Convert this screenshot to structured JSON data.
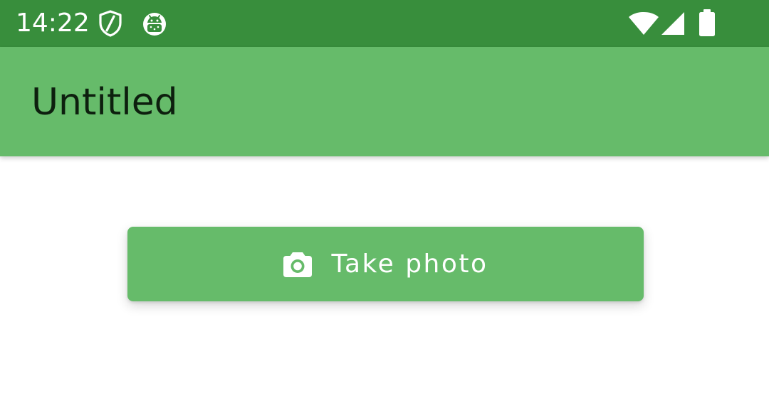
{
  "status_bar": {
    "time": "14:22",
    "background_color": "#388e3c",
    "left_icons": [
      "shield-icon",
      "android-icon"
    ],
    "right_icons": [
      "wifi-icon",
      "cellular-signal-icon",
      "battery-icon"
    ]
  },
  "app_bar": {
    "title": "Untitled",
    "background_color": "#66bb6a"
  },
  "main": {
    "take_photo_button": {
      "icon": "camera-icon",
      "label": "Take photo",
      "background_color": "#66bb6a"
    }
  }
}
